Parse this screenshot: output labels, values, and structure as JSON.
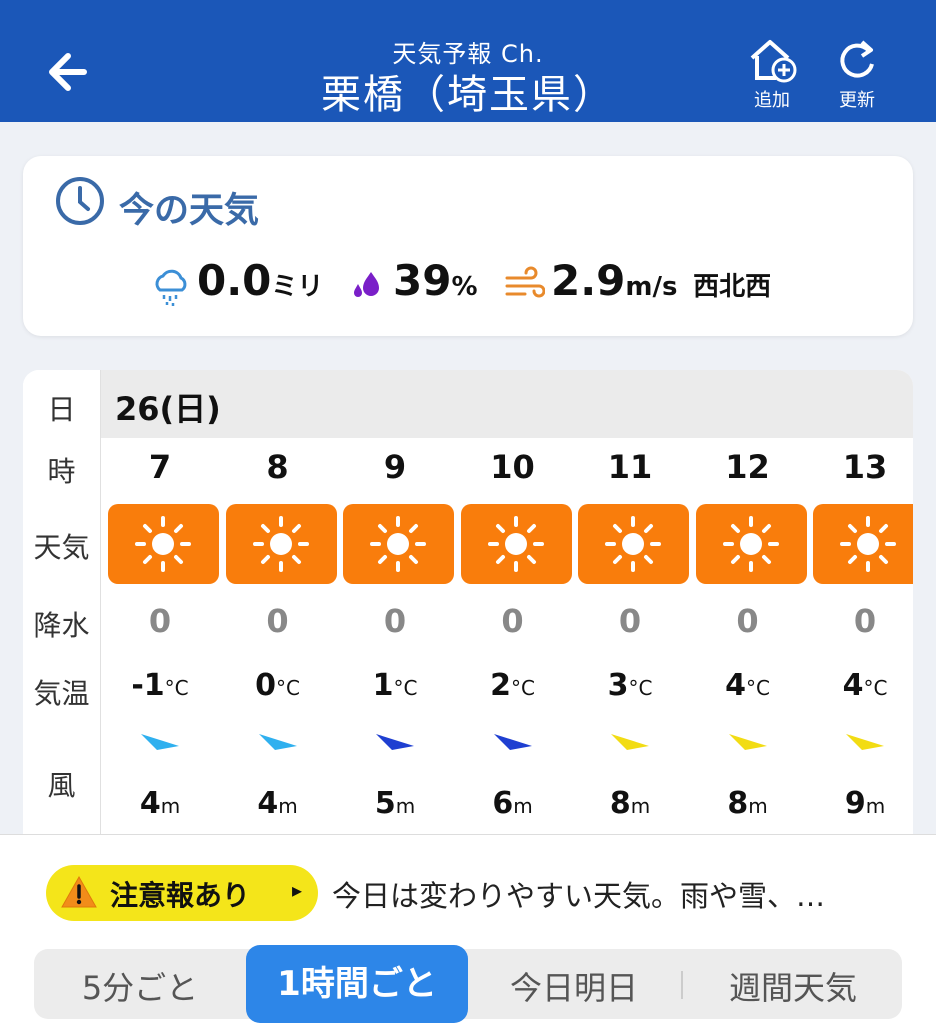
{
  "header": {
    "subtitle": "天気予報 Ch.",
    "title": "栗橋（埼玉県）",
    "add_label": "追加",
    "refresh_label": "更新"
  },
  "current": {
    "title": "今の天気",
    "precip_value": "0.0",
    "precip_unit": "ミリ",
    "humidity_value": "39",
    "humidity_unit": "%",
    "wind_value": "2.9",
    "wind_unit": "m/s",
    "wind_dir": "西北西"
  },
  "forecast": {
    "row_labels": {
      "day": "日",
      "hour": "時",
      "weather": "天気",
      "precip": "降水",
      "temp": "気温",
      "wind": "風"
    },
    "day": "26(日)",
    "hours": [
      {
        "hour": "7",
        "weather_icon": "sun-icon",
        "precip": "0",
        "temp": "-1",
        "temp_unit": "°C",
        "wind": "4",
        "wind_unit": "m",
        "wind_color": "#2fb0ef"
      },
      {
        "hour": "8",
        "weather_icon": "sun-icon",
        "precip": "0",
        "temp": "0",
        "temp_unit": "°C",
        "wind": "4",
        "wind_unit": "m",
        "wind_color": "#2fb0ef"
      },
      {
        "hour": "9",
        "weather_icon": "sun-icon",
        "precip": "0",
        "temp": "1",
        "temp_unit": "°C",
        "wind": "5",
        "wind_unit": "m",
        "wind_color": "#1f3fd1"
      },
      {
        "hour": "10",
        "weather_icon": "sun-icon",
        "precip": "0",
        "temp": "2",
        "temp_unit": "°C",
        "wind": "6",
        "wind_unit": "m",
        "wind_color": "#1f3fd1"
      },
      {
        "hour": "11",
        "weather_icon": "sun-icon",
        "precip": "0",
        "temp": "3",
        "temp_unit": "°C",
        "wind": "8",
        "wind_unit": "m",
        "wind_color": "#f2dc14"
      },
      {
        "hour": "12",
        "weather_icon": "sun-icon",
        "precip": "0",
        "temp": "4",
        "temp_unit": "°C",
        "wind": "8",
        "wind_unit": "m",
        "wind_color": "#f2dc14"
      },
      {
        "hour": "13",
        "weather_icon": "sun-icon",
        "precip": "0",
        "temp": "4",
        "temp_unit": "°C",
        "wind": "9",
        "wind_unit": "m",
        "wind_color": "#f2dc14"
      }
    ]
  },
  "alert": {
    "badge": "注意報あり",
    "text": "今日は変わりやすい天気。雨や雪、…"
  },
  "tabs": {
    "five_min": "5分ごと",
    "hourly": "1時間ごと",
    "today_tomorrow": "今日明日",
    "weekly": "週間天気"
  },
  "colors": {
    "header_bg": "#1b57b8",
    "sunny_bg": "#f97d0c",
    "active_tab": "#2d86e8",
    "alert_bg": "#f4e51a"
  }
}
